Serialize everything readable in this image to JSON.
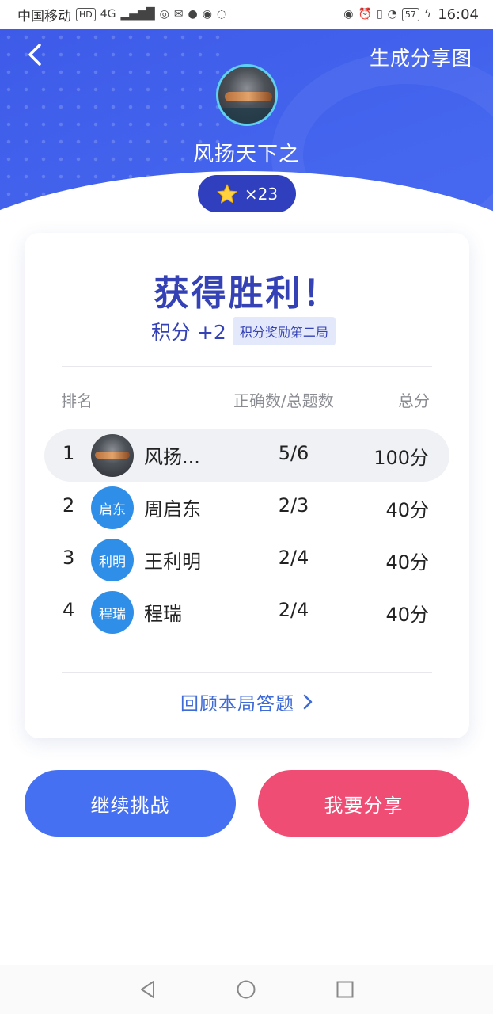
{
  "status_bar": {
    "carrier": "中国移动",
    "hd": "HD",
    "network": "4G",
    "battery": "57",
    "time": "16:04"
  },
  "header": {
    "share_image_label": "生成分享图",
    "username": "风扬天下之",
    "stars": "×23"
  },
  "result": {
    "title": "获得胜利！",
    "score_delta": "积分 +2",
    "score_tag": "积分奖励第二局",
    "columns": {
      "rank": "排名",
      "correct_ratio": "正确数/总题数",
      "total": "总分"
    },
    "rows": [
      {
        "rank": "1",
        "avatar": "",
        "name": "风扬...",
        "ratio": "5/6",
        "score": "100分"
      },
      {
        "rank": "2",
        "avatar": "启东",
        "name": "周启东",
        "ratio": "2/3",
        "score": "40分"
      },
      {
        "rank": "3",
        "avatar": "利明",
        "name": "王利明",
        "ratio": "2/4",
        "score": "40分"
      },
      {
        "rank": "4",
        "avatar": "程瑞",
        "name": "程瑞",
        "ratio": "2/4",
        "score": "40分"
      }
    ],
    "review_label": "回顾本局答题"
  },
  "actions": {
    "continue_label": "继续挑战",
    "share_label": "我要分享"
  },
  "colors": {
    "primary": "#4670f2",
    "accent": "#f04d75",
    "title": "#3542b5",
    "hero": "#4566ef"
  }
}
